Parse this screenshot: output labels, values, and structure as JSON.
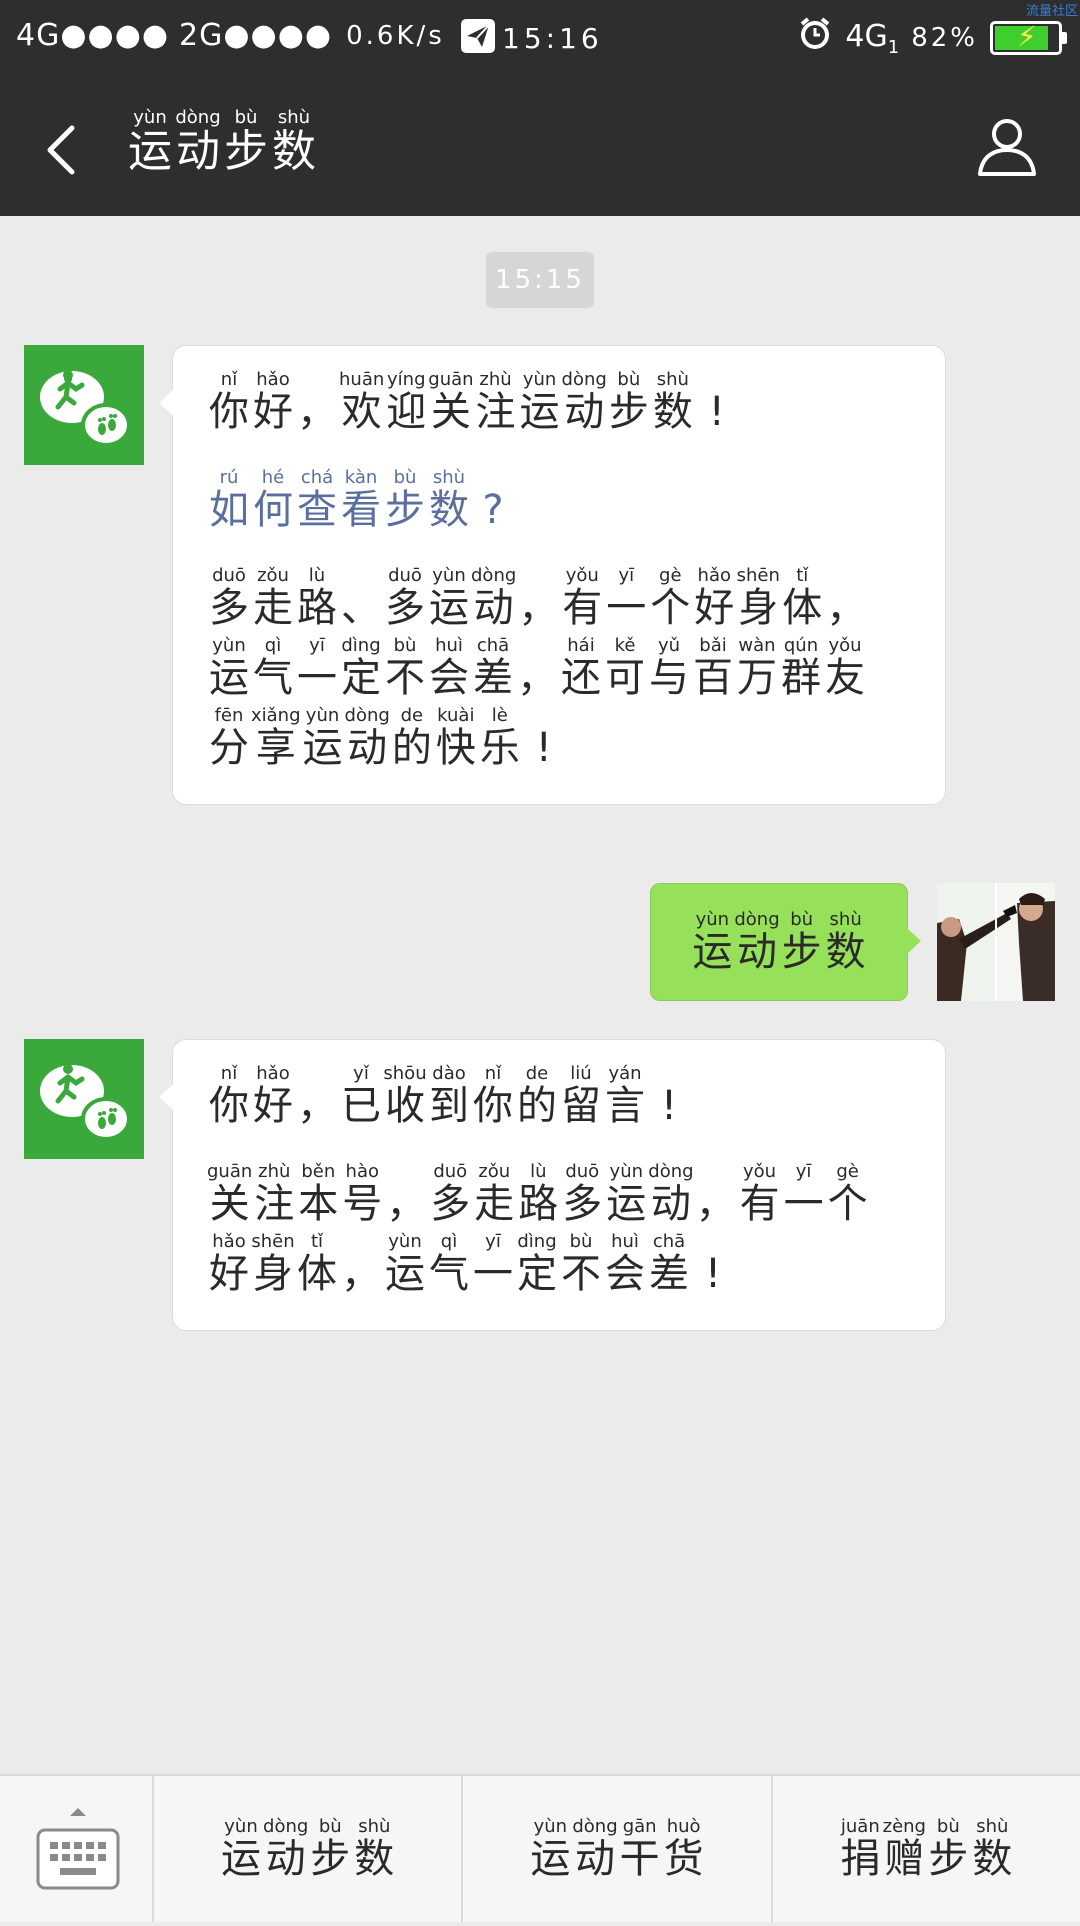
{
  "status_bar": {
    "signal1": "4G●●●● ",
    "signal2": "2G●●●●",
    "speed": "0.6K/s",
    "time": "15:16",
    "network": "4G",
    "network_sub": "1",
    "battery": "82%",
    "corner_tag": "流量社区"
  },
  "header": {
    "title": [
      {
        "py": "yùn",
        "hz": "运"
      },
      {
        "py": "dòng",
        "hz": "动"
      },
      {
        "py": "bù",
        "hz": "步"
      },
      {
        "py": "shù",
        "hz": "数"
      }
    ]
  },
  "chat": {
    "timestamp": "15:15",
    "msg1": {
      "p1": [
        [
          {
            "py": "nǐ",
            "hz": "你"
          },
          {
            "py": "hǎo",
            "hz": "好"
          },
          {
            "py": "",
            "hz": "，"
          },
          {
            "py": "huān",
            "hz": "欢"
          },
          {
            "py": "yíng",
            "hz": "迎"
          },
          {
            "py": "guān",
            "hz": "关"
          },
          {
            "py": "zhù",
            "hz": "注"
          },
          {
            "py": "yùn",
            "hz": "运"
          },
          {
            "py": "dòng",
            "hz": "动"
          },
          {
            "py": "bù",
            "hz": "步"
          },
          {
            "py": "shù",
            "hz": "数"
          },
          {
            "py": "",
            "hz": "!"
          }
        ]
      ],
      "p2": [
        [
          {
            "py": "rú",
            "hz": "如"
          },
          {
            "py": "hé",
            "hz": "何"
          },
          {
            "py": "chá",
            "hz": "查"
          },
          {
            "py": "kàn",
            "hz": "看"
          },
          {
            "py": "bù",
            "hz": "步"
          },
          {
            "py": "shù",
            "hz": "数"
          },
          {
            "py": "",
            "hz": "?"
          }
        ]
      ],
      "p3": [
        [
          {
            "py": "duō",
            "hz": "多"
          },
          {
            "py": "zǒu",
            "hz": "走"
          },
          {
            "py": "lù",
            "hz": "路"
          },
          {
            "py": "",
            "hz": "、"
          },
          {
            "py": "duō",
            "hz": "多"
          },
          {
            "py": "yùn",
            "hz": "运"
          },
          {
            "py": "dòng",
            "hz": "动"
          },
          {
            "py": "",
            "hz": "，"
          },
          {
            "py": "yǒu",
            "hz": "有"
          },
          {
            "py": "yī",
            "hz": "一"
          },
          {
            "py": "gè",
            "hz": "个"
          },
          {
            "py": "hǎo",
            "hz": "好"
          },
          {
            "py": "shēn",
            "hz": "身"
          },
          {
            "py": "tǐ",
            "hz": "体"
          },
          {
            "py": "",
            "hz": "，"
          }
        ],
        [
          {
            "py": "yùn",
            "hz": "运"
          },
          {
            "py": "qì",
            "hz": "气"
          },
          {
            "py": "yī",
            "hz": "一"
          },
          {
            "py": "dìng",
            "hz": "定"
          },
          {
            "py": "bù",
            "hz": "不"
          },
          {
            "py": "huì",
            "hz": "会"
          },
          {
            "py": "chā",
            "hz": "差"
          },
          {
            "py": "",
            "hz": "，"
          },
          {
            "py": "hái",
            "hz": "还"
          },
          {
            "py": "kě",
            "hz": "可"
          },
          {
            "py": "yǔ",
            "hz": "与"
          },
          {
            "py": "bǎi",
            "hz": "百"
          },
          {
            "py": "wàn",
            "hz": "万"
          },
          {
            "py": "qún",
            "hz": "群"
          },
          {
            "py": "yǒu",
            "hz": "友"
          }
        ],
        [
          {
            "py": "fēn",
            "hz": "分"
          },
          {
            "py": "xiǎng",
            "hz": "享"
          },
          {
            "py": "yùn",
            "hz": "运"
          },
          {
            "py": "dòng",
            "hz": "动"
          },
          {
            "py": "de",
            "hz": "的"
          },
          {
            "py": "kuài",
            "hz": "快"
          },
          {
            "py": "lè",
            "hz": "乐"
          },
          {
            "py": "",
            "hz": "!"
          }
        ]
      ]
    },
    "msg2": [
      [
        {
          "py": "yùn",
          "hz": "运"
        },
        {
          "py": "dòng",
          "hz": "动"
        },
        {
          "py": "bù",
          "hz": "步"
        },
        {
          "py": "shù",
          "hz": "数"
        }
      ]
    ],
    "msg3": {
      "p1": [
        [
          {
            "py": "nǐ",
            "hz": "你"
          },
          {
            "py": "hǎo",
            "hz": "好"
          },
          {
            "py": "",
            "hz": "，"
          },
          {
            "py": "yǐ",
            "hz": "已"
          },
          {
            "py": "shōu",
            "hz": "收"
          },
          {
            "py": "dào",
            "hz": "到"
          },
          {
            "py": "nǐ",
            "hz": "你"
          },
          {
            "py": "de",
            "hz": "的"
          },
          {
            "py": "liú",
            "hz": "留"
          },
          {
            "py": "yán",
            "hz": "言"
          },
          {
            "py": "",
            "hz": "!"
          }
        ]
      ],
      "p2": [
        [
          {
            "py": "guān",
            "hz": "关"
          },
          {
            "py": "zhù",
            "hz": "注"
          },
          {
            "py": "běn",
            "hz": "本"
          },
          {
            "py": "hào",
            "hz": "号"
          },
          {
            "py": "",
            "hz": "，"
          },
          {
            "py": "duō",
            "hz": "多"
          },
          {
            "py": "zǒu",
            "hz": "走"
          },
          {
            "py": "lù",
            "hz": "路"
          },
          {
            "py": "duō",
            "hz": "多"
          },
          {
            "py": "yùn",
            "hz": "运"
          },
          {
            "py": "dòng",
            "hz": "动"
          },
          {
            "py": "",
            "hz": "，"
          },
          {
            "py": "yǒu",
            "hz": "有"
          },
          {
            "py": "yī",
            "hz": "一"
          },
          {
            "py": "gè",
            "hz": "个"
          }
        ],
        [
          {
            "py": "hǎo",
            "hz": "好"
          },
          {
            "py": "shēn",
            "hz": "身"
          },
          {
            "py": "tǐ",
            "hz": "体"
          },
          {
            "py": "",
            "hz": "，"
          },
          {
            "py": "yùn",
            "hz": "运"
          },
          {
            "py": "qì",
            "hz": "气"
          },
          {
            "py": "yī",
            "hz": "一"
          },
          {
            "py": "dìng",
            "hz": "定"
          },
          {
            "py": "bù",
            "hz": "不"
          },
          {
            "py": "huì",
            "hz": "会"
          },
          {
            "py": "chā",
            "hz": "差"
          },
          {
            "py": "",
            "hz": "!"
          }
        ]
      ]
    }
  },
  "bottom_menu": [
    [
      {
        "py": "yùn",
        "hz": "运"
      },
      {
        "py": "dòng",
        "hz": "动"
      },
      {
        "py": "bù",
        "hz": "步"
      },
      {
        "py": "shù",
        "hz": "数"
      }
    ],
    [
      {
        "py": "yùn",
        "hz": "运"
      },
      {
        "py": "dòng",
        "hz": "动"
      },
      {
        "py": "gān",
        "hz": "干"
      },
      {
        "py": "huò",
        "hz": "货"
      }
    ],
    [
      {
        "py": "juān",
        "hz": "捐"
      },
      {
        "py": "zèng",
        "hz": "赠"
      },
      {
        "py": "bù",
        "hz": "步"
      },
      {
        "py": "shù",
        "hz": "数"
      }
    ]
  ],
  "colors": {
    "header_bg": "#2e2e2e",
    "chat_bg": "#ebebeb",
    "bot_avatar": "#3aa83a",
    "sent_bubble": "#97e05a",
    "link_text": "#5a6fa0"
  },
  "icons": [
    "back-arrow-icon",
    "profile-icon",
    "keyboard-icon",
    "alarm-icon",
    "send-icon",
    "battery-icon",
    "runner-logo-icon"
  ]
}
